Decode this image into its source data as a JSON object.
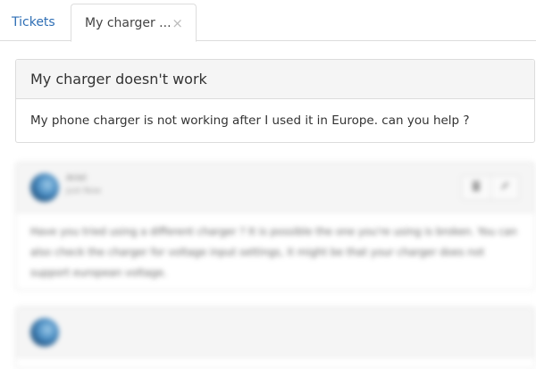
{
  "tabs": {
    "list_label": "Tickets",
    "active_label": "My charger ...",
    "close_glyph": "×"
  },
  "ticket": {
    "subject": "My charger doesn't work",
    "message": "My phone charger is not working after I used it in Europe. can you help ?"
  },
  "replies": [
    {
      "author": "Ariel",
      "time": "Just Now",
      "text": "Have you tried using a different charger ? It is possible the one you're using is broken. You can also check the charger for voltage input settings, it might be that your charger does not support european voltage.",
      "actions": [
        "trash-icon",
        "pencil-icon"
      ]
    },
    {
      "author": "",
      "time": "",
      "text": ""
    }
  ],
  "colors": {
    "link": "#2f6fb5",
    "panel_header": "#f5f5f5",
    "border": "#dcdcdc"
  }
}
